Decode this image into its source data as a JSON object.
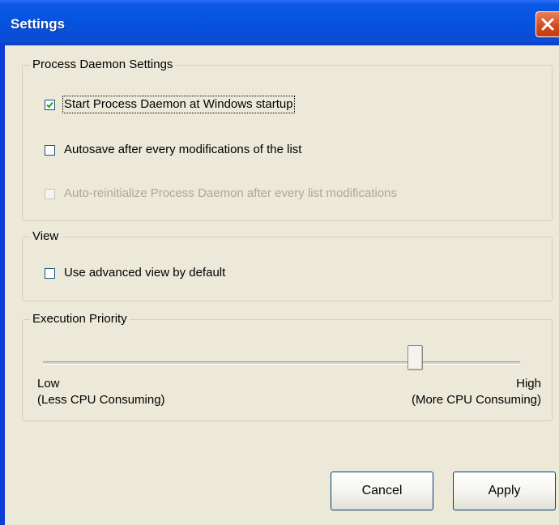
{
  "window": {
    "title": "Settings",
    "close_icon": "close-icon"
  },
  "colors": {
    "titlebar": "#0653de",
    "client_bg": "#ece9d8",
    "close_button": "#d04a20",
    "disabled_text": "#aca899"
  },
  "groups": {
    "daemon": {
      "legend": "Process Daemon Settings",
      "options": [
        {
          "label": "Start Process Daemon at Windows startup",
          "checked": true,
          "enabled": true
        },
        {
          "label": "Autosave after every modifications of the list",
          "checked": false,
          "enabled": true
        },
        {
          "label": "Auto-reinitialize Process Daemon after every list modifications",
          "checked": false,
          "enabled": false
        }
      ]
    },
    "view": {
      "legend": "View",
      "options": [
        {
          "label": "Use advanced view by default",
          "checked": false,
          "enabled": true
        }
      ]
    },
    "priority": {
      "legend": "Execution Priority",
      "slider_value": 0.78,
      "low_label": "Low",
      "low_sub": "(Less CPU Consuming)",
      "high_label": "High",
      "high_sub": "(More CPU Consuming)"
    }
  },
  "buttons": {
    "cancel": "Cancel",
    "apply": "Apply"
  }
}
